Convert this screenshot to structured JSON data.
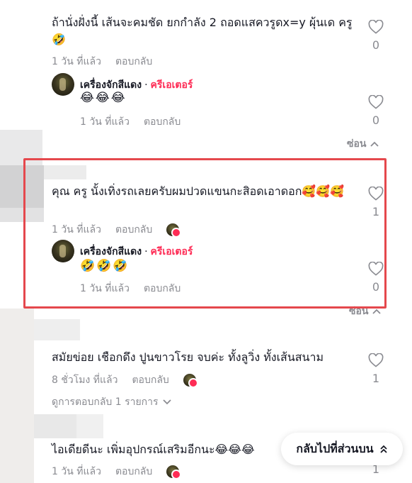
{
  "comments": [
    {
      "text": "ถ้านั่งฝั่งนี้ เส้นจะคมชัด ยกกำลัง 2 ถอดแสควรูดx=y ผุ้นเด ครู🤣",
      "time": "1 วัน ที่แล้ว",
      "reply_label": "ตอบกลับ",
      "likes": "0",
      "reply": {
        "username": "เครื่องจักสีแดง",
        "separator": "·",
        "creator_label": "ครีเอเตอร์",
        "emojis": "😂😂😂",
        "time": "1 วัน ที่แล้ว",
        "reply_label": "ตอบกลับ",
        "likes": "0"
      },
      "hide_label": "ซ่อน"
    },
    {
      "text": "คุณ ครู นั้งเทิ่งรถเลยครับผมปวดแขนกะสิอดเอาดอก🥰🥰🥰",
      "time": "1 วัน ที่แล้ว",
      "reply_label": "ตอบกลับ",
      "likes": "1",
      "reply": {
        "username": "เครื่องจักสีแดง",
        "separator": "·",
        "creator_label": "ครีเอเตอร์",
        "emojis": "🤣🤣🤣",
        "time": "1 วัน ที่แล้ว",
        "reply_label": "ตอบกลับ",
        "likes": "0"
      },
      "hide_label": "ซ่อน"
    },
    {
      "text": "สมัยข่อย เชือกดึง ปูนขาวโรย จบค่ะ ทั้งลูวิ่ง ทั้งเส้นสนาม",
      "time": "8 ชั่วโมง ที่แล้ว",
      "reply_label": "ตอบกลับ",
      "likes": "1",
      "view_replies": "ดูการตอบกลับ 1 รายการ"
    },
    {
      "text": "ไอเดียดีนะ เพิ่มอุปกรณ์เสริมอีกนะ😂😂😂",
      "time": "1 วัน ที่แล้ว",
      "reply_label": "ตอบกลับ",
      "likes": "1"
    }
  ],
  "back_to_top": "กลับไปที่ส่วนบน",
  "icons": {
    "like": "heart-outline-icon",
    "hide": "chevron-up-icon",
    "view": "chevron-down-icon",
    "back": "double-chevron-up-icon"
  },
  "colors": {
    "creator": "#fe2c55",
    "highlight": "#e5484d",
    "muted": "#8a8b91"
  }
}
